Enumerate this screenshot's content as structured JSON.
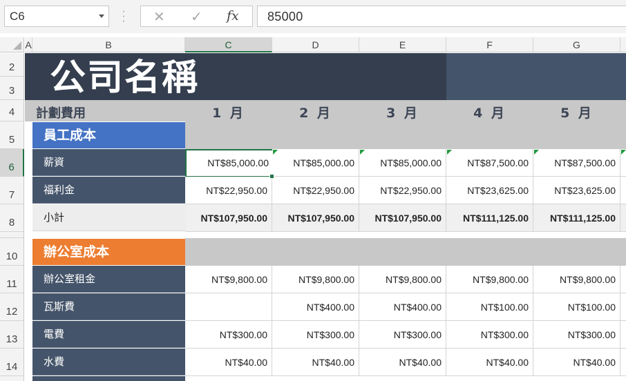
{
  "formula_bar": {
    "name_box": "C6",
    "formula": "85000",
    "cancel_icon": "x-icon",
    "enter_icon": "check-icon",
    "fx_label": "fx"
  },
  "columns": [
    "A",
    "B",
    "C",
    "D",
    "E",
    "F",
    "G"
  ],
  "rows": [
    "2",
    "3",
    "4",
    "5",
    "6",
    "7",
    "8",
    "10",
    "11",
    "12",
    "13",
    "14"
  ],
  "sheet": {
    "title": "公司名稱",
    "header_label": "計劃費用",
    "months": [
      "1 月",
      "2 月",
      "3 月",
      "4 月",
      "5 月"
    ],
    "employee_section": "員工成本",
    "office_section": "辦公室成本",
    "employee_rows": [
      {
        "label": "薪資",
        "values": [
          "NT$85,000.00",
          "NT$85,000.00",
          "NT$85,000.00",
          "NT$87,500.00",
          "NT$87,500.00"
        ]
      },
      {
        "label": "福利金",
        "values": [
          "NT$22,950.00",
          "NT$22,950.00",
          "NT$22,950.00",
          "NT$23,625.00",
          "NT$23,625.00"
        ]
      },
      {
        "label": "小計",
        "values": [
          "NT$107,950.00",
          "NT$107,950.00",
          "NT$107,950.00",
          "NT$111,125.00",
          "NT$111,125.00"
        ]
      }
    ],
    "office_rows": [
      {
        "label": "辦公室租金",
        "values": [
          "NT$9,800.00",
          "NT$9,800.00",
          "NT$9,800.00",
          "NT$9,800.00",
          "NT$9,800.00"
        ]
      },
      {
        "label": "瓦斯費",
        "values": [
          "",
          "NT$400.00",
          "NT$400.00",
          "NT$100.00",
          "NT$100.00"
        ]
      },
      {
        "label": "電費",
        "values": [
          "NT$300.00",
          "NT$300.00",
          "NT$300.00",
          "NT$300.00",
          "NT$300.00"
        ]
      },
      {
        "label": "水費",
        "values": [
          "NT$40.00",
          "NT$40.00",
          "NT$40.00",
          "NT$40.00",
          "NT$40.00"
        ]
      }
    ]
  },
  "colors": {
    "title_band": "#343e4e",
    "label_band": "#44546a",
    "employee_section": "#4472c4",
    "office_section": "#ed7d31",
    "selection": "#217346"
  }
}
